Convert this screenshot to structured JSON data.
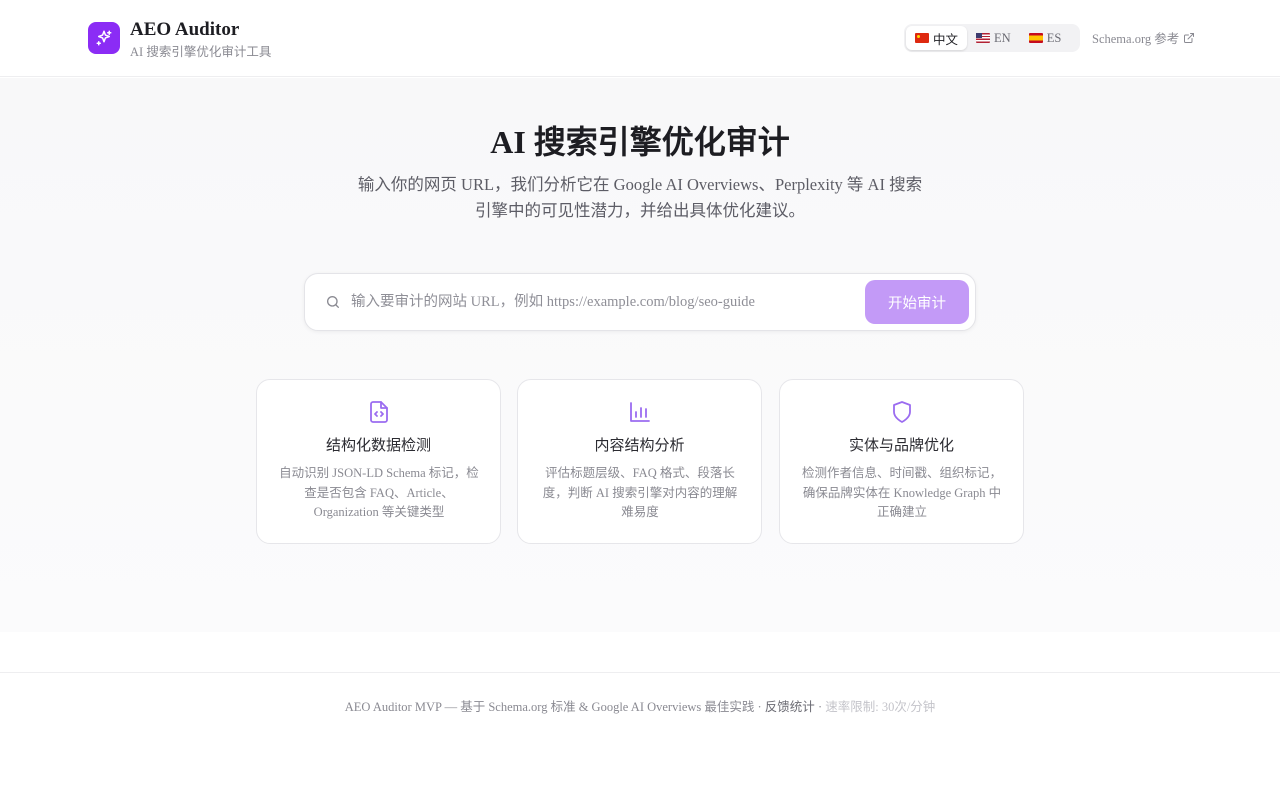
{
  "header": {
    "title": "AEO Auditor",
    "subtitle": "AI 搜索引擎优化审计工具",
    "logo_icon": "sparkles-icon",
    "accent": "#8b2cf5",
    "languages": [
      {
        "label": "中文",
        "flag": "cn",
        "active": true
      },
      {
        "label": "EN",
        "flag": "us",
        "active": false
      },
      {
        "label": "ES",
        "flag": "es",
        "active": false
      }
    ],
    "schema_link": "Schema.org 参考"
  },
  "hero": {
    "title": "AI 搜索引擎优化审计",
    "description": "输入你的网页 URL，我们分析它在 Google AI Overviews、Perplexity 等 AI 搜索引擎中的可见性潜力，并给出具体优化建议。"
  },
  "search": {
    "value": "",
    "placeholder": "输入要审计的网站 URL，例如 https://example.com/blog/seo-guide",
    "button_label": "开始审计",
    "button_color": "#c39af7"
  },
  "features": [
    {
      "icon": "file-code-icon",
      "title": "结构化数据检测",
      "description": "自动识别 JSON-LD Schema 标记，检查是否包含 FAQ、Article、Organization 等关键类型"
    },
    {
      "icon": "bar-chart-icon",
      "title": "内容结构分析",
      "description": "评估标题层级、FAQ 格式、段落长度，判断 AI 搜索引擎对内容的理解难易度"
    },
    {
      "icon": "shield-icon",
      "title": "实体与品牌优化",
      "description": "检测作者信息、时间戳、组织标记，确保品牌实体在 Knowledge Graph 中正确建立"
    }
  ],
  "footer": {
    "text": "AEO Auditor MVP — 基于 Schema.org 标准 & Google AI Overviews 最佳实践 · ",
    "feedback_link": "反馈统计",
    "separator": " · ",
    "rate_limit": "速率限制: 30次/分钟"
  }
}
